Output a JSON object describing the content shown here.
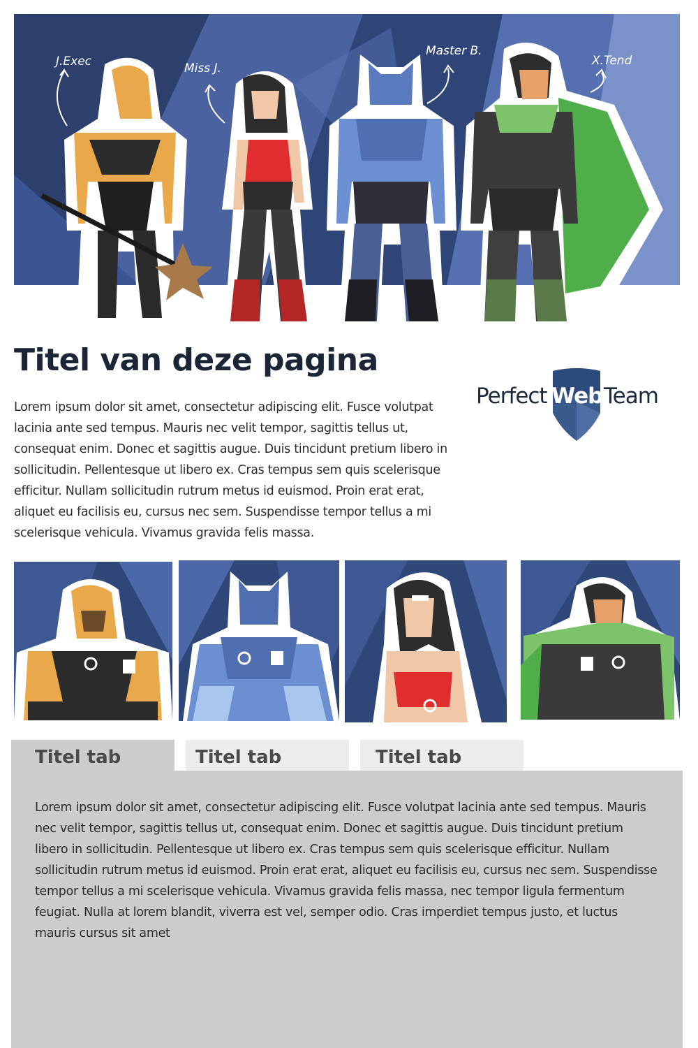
{
  "hero": {
    "labels": [
      "J.Exec",
      "Miss J.",
      "Master B.",
      "X.Tend"
    ]
  },
  "page": {
    "title": "Titel van deze pagina",
    "intro": "Lorem ipsum dolor sit amet, consectetur adipiscing elit. Fusce volutpat lacinia ante sed tempus. Mauris nec velit tempor, sagittis tellus ut, consequat enim. Donec et sagittis augue. Duis tincidunt pretium libero in sollicitudin. Pellentesque ut libero ex. Cras tempus sem quis scelerisque efficitur. Nullam sollicitudin rutrum metus id euismod. Proin erat erat, aliquet eu facilisis eu, cursus nec sem. Suspendisse tempor tellus a mi scelerisque vehicula. Vivamus gravida felis massa."
  },
  "logo": {
    "left": "Perfect",
    "mid": "Web",
    "right": "Team"
  },
  "tabs": {
    "items": [
      {
        "label": "Titel tab"
      },
      {
        "label": "Titel tab"
      },
      {
        "label": "Titel tab"
      }
    ],
    "active_index": 0,
    "panel_text": "Lorem ipsum dolor sit amet, consectetur adipiscing elit. Fusce volutpat lacinia ante sed tempus. Mauris nec velit tempor, sagittis tellus ut, consequat enim. Donec et sagittis augue. Duis tincidunt pretium libero in sollicitudin. Pellentesque ut libero ex. Cras tempus sem quis scelerisque efficitur. Nullam sollicitudin rutrum metus id euismod. Proin erat erat, aliquet eu facilisis eu, cursus nec sem. Suspendisse tempor tellus a mi scelerisque vehicula. Vivamus gravida felis massa, nec tempor ligula fermentum feugiat. Nulla at lorem blandit, viverra est vel, semper odio. Cras imperdiet tempus justo, et luctus mauris cursus sit amet"
  },
  "colors": {
    "hero_background": "#3d5584",
    "title": "#1a2636",
    "tab_active": "#cccccc",
    "tab_inactive": "#ececec",
    "logo_shield": "#3b5a8c"
  }
}
